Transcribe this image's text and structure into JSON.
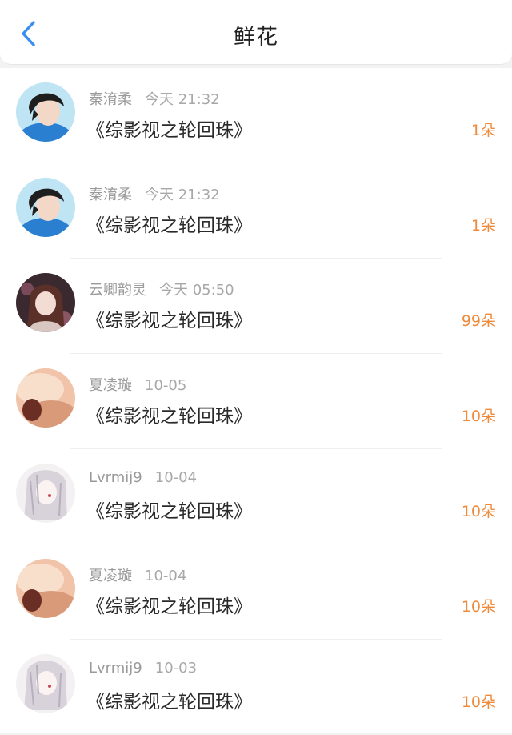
{
  "header": {
    "title": "鲜花"
  },
  "icons": {
    "back": "chevron-left-icon"
  },
  "colors": {
    "accent": "#3a8ef0",
    "amount": "#ef8a3a"
  },
  "items": [
    {
      "user": "秦淯柔",
      "time": "今天 21:32",
      "book": "《综影视之轮回珠》",
      "amount": "1朵",
      "avatar": "avatar-a"
    },
    {
      "user": "秦淯柔",
      "time": "今天 21:32",
      "book": "《综影视之轮回珠》",
      "amount": "1朵",
      "avatar": "avatar-a"
    },
    {
      "user": "云卿韵灵",
      "time": "今天 05:50",
      "book": "《综影视之轮回珠》",
      "amount": "99朵",
      "avatar": "avatar-b"
    },
    {
      "user": "夏凌璇",
      "time": "10-05",
      "book": "《综影视之轮回珠》",
      "amount": "10朵",
      "avatar": "avatar-c"
    },
    {
      "user": "Lvrmij9",
      "time": "10-04",
      "book": "《综影视之轮回珠》",
      "amount": "10朵",
      "avatar": "avatar-d"
    },
    {
      "user": "夏凌璇",
      "time": "10-04",
      "book": "《综影视之轮回珠》",
      "amount": "10朵",
      "avatar": "avatar-c"
    },
    {
      "user": "Lvrmij9",
      "time": "10-03",
      "book": "《综影视之轮回珠》",
      "amount": "10朵",
      "avatar": "avatar-d"
    }
  ]
}
